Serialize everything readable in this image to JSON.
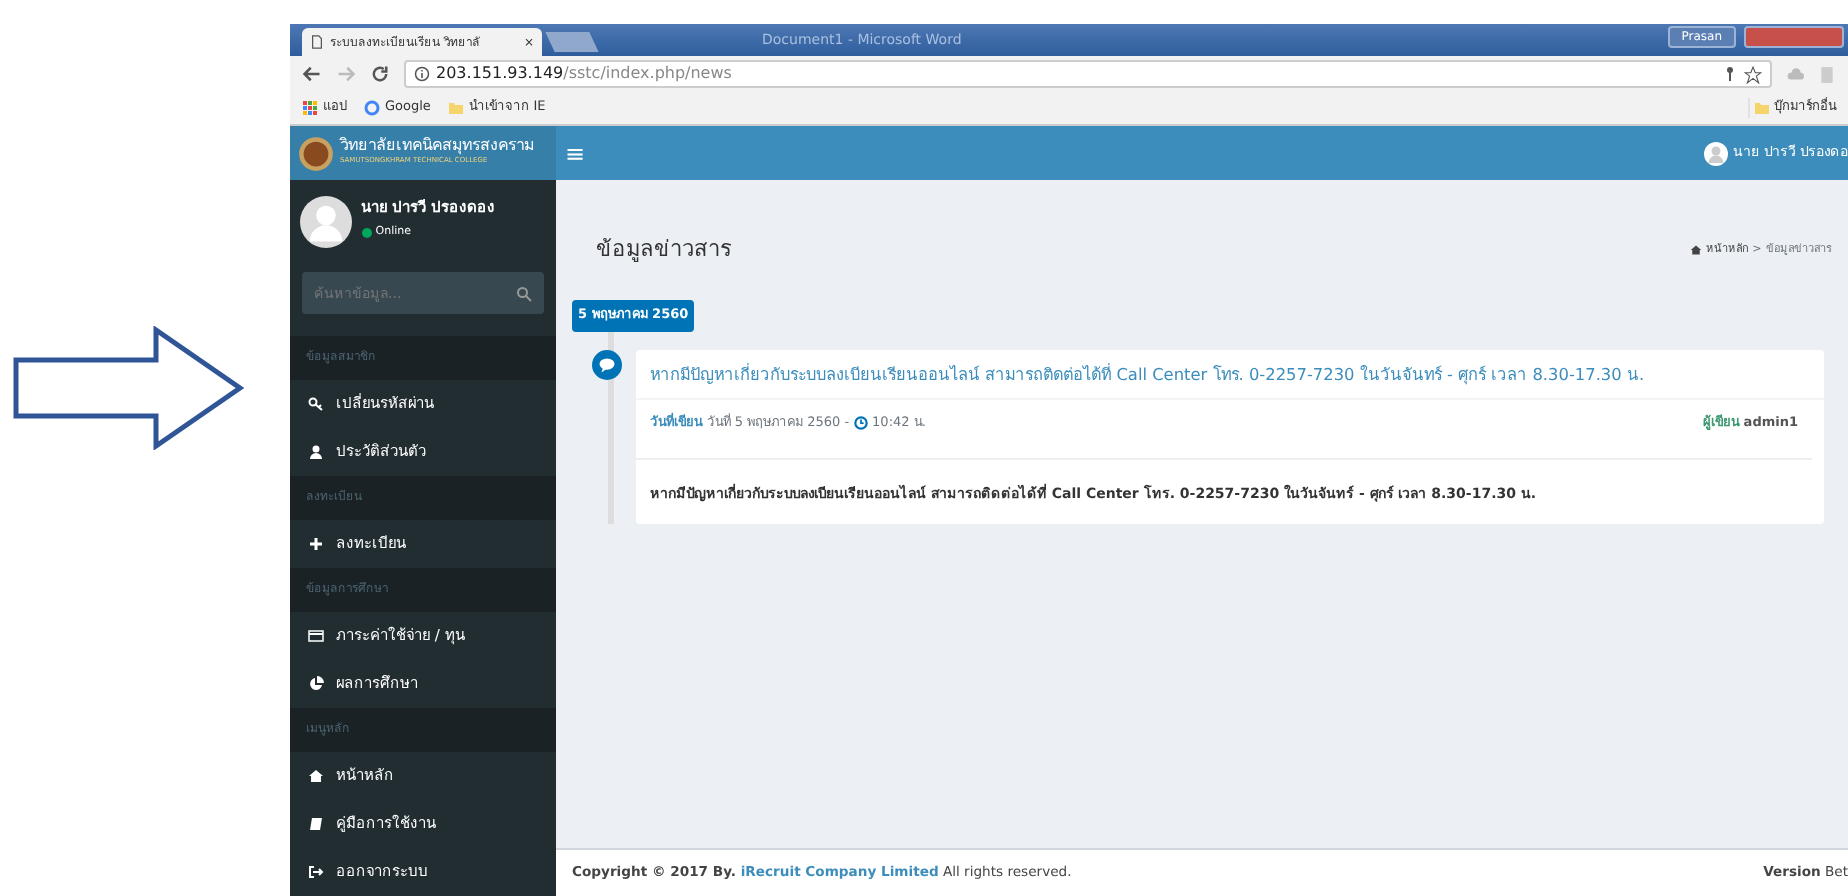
{
  "browser": {
    "tab_title": "ระบบลงทะเบียนเรียน วิทยาลั",
    "tab_close": "×",
    "window_title": "Document1 - Microsoft Word",
    "user_button": "Prasan",
    "address": {
      "host": "203.151.93.149",
      "path": "/sstc/index.php/news"
    },
    "bookmarks": [
      "แอป",
      "Google",
      "นำเข้าจาก IE"
    ],
    "other_bookmarks": "บุ๊กมาร์กอื่น"
  },
  "header": {
    "logo_title": "วิทยาลัยเทคนิคสมุทรสงคราม",
    "logo_subtitle": "SAMUTSONGKHRAM TECHNICAL COLLEGE",
    "menu_toggle": "≡",
    "user_name": "นาย ปารวี ปรองดอ"
  },
  "sidebar": {
    "user_name": "นาย ปารวี ปรองดอง",
    "status": "Online",
    "search": {
      "placeholder": "ค้นหาข้อมูล..."
    },
    "items": [
      {
        "kind": "header",
        "label": "ข้อมูลสมาชิก"
      },
      {
        "kind": "link",
        "label": "เปลี่ยนรหัสผ่าน"
      },
      {
        "kind": "link",
        "label": "ประวัติส่วนตัว"
      },
      {
        "kind": "header",
        "label": "ลงทะเบียน"
      },
      {
        "kind": "link",
        "label": "ลงทะเบียน"
      },
      {
        "kind": "header",
        "label": "ข้อมูลการศึกษา"
      },
      {
        "kind": "link",
        "label": "ภาระค่าใช้จ่าย / ทุน"
      },
      {
        "kind": "link",
        "label": "ผลการศึกษา"
      },
      {
        "kind": "header",
        "label": "เมนูหลัก"
      },
      {
        "kind": "link",
        "label": "หน้าหลัก"
      },
      {
        "kind": "link",
        "label": "คู่มือการใช้งาน"
      },
      {
        "kind": "link",
        "label": "ออกจากระบบ"
      }
    ]
  },
  "content": {
    "title": "ข้อมูลข่าวสาร",
    "breadcrumb": [
      "หน้าหลัก",
      "ข้อมูลข่าวสาร"
    ],
    "breadcrumb_separator": ">",
    "timeline": [
      {
        "date": "5 พฤษภาคม 2560",
        "headline": "หากมีปัญหาเกี่ยวกับระบบลงเบียนเรียนออนไลน์ สามารถติดต่อได้ที่ Call Center โทร. 0-2257-7230 ในวันจันทร์ - ศุกร์ เวลา 8.30-17.30 น.",
        "date_label": "วันที่เขียน",
        "date_text": "วันที่ 5 พฤษภาคม 2560 -",
        "time": "10:42 น.",
        "author": "**ผู้เขียน** admin1",
        "body": "หากมีปัญหาเกี่ยวกับระบบลงเบียนเรียนออนไลน์ สามารถติดต่อได้ที่ Call Center โทร. 0-2257-7230 ในวันจันทร์ - ศุกร์ เวลา 8.30-17.30 น."
      }
    ]
  },
  "footer": {
    "copyright_prefix": "Copyright © 2017 By.",
    "company": "iRecruit Company Limited",
    "copyright_suffix": "All rights reserved.",
    "version": "**Version** Bet"
  }
}
